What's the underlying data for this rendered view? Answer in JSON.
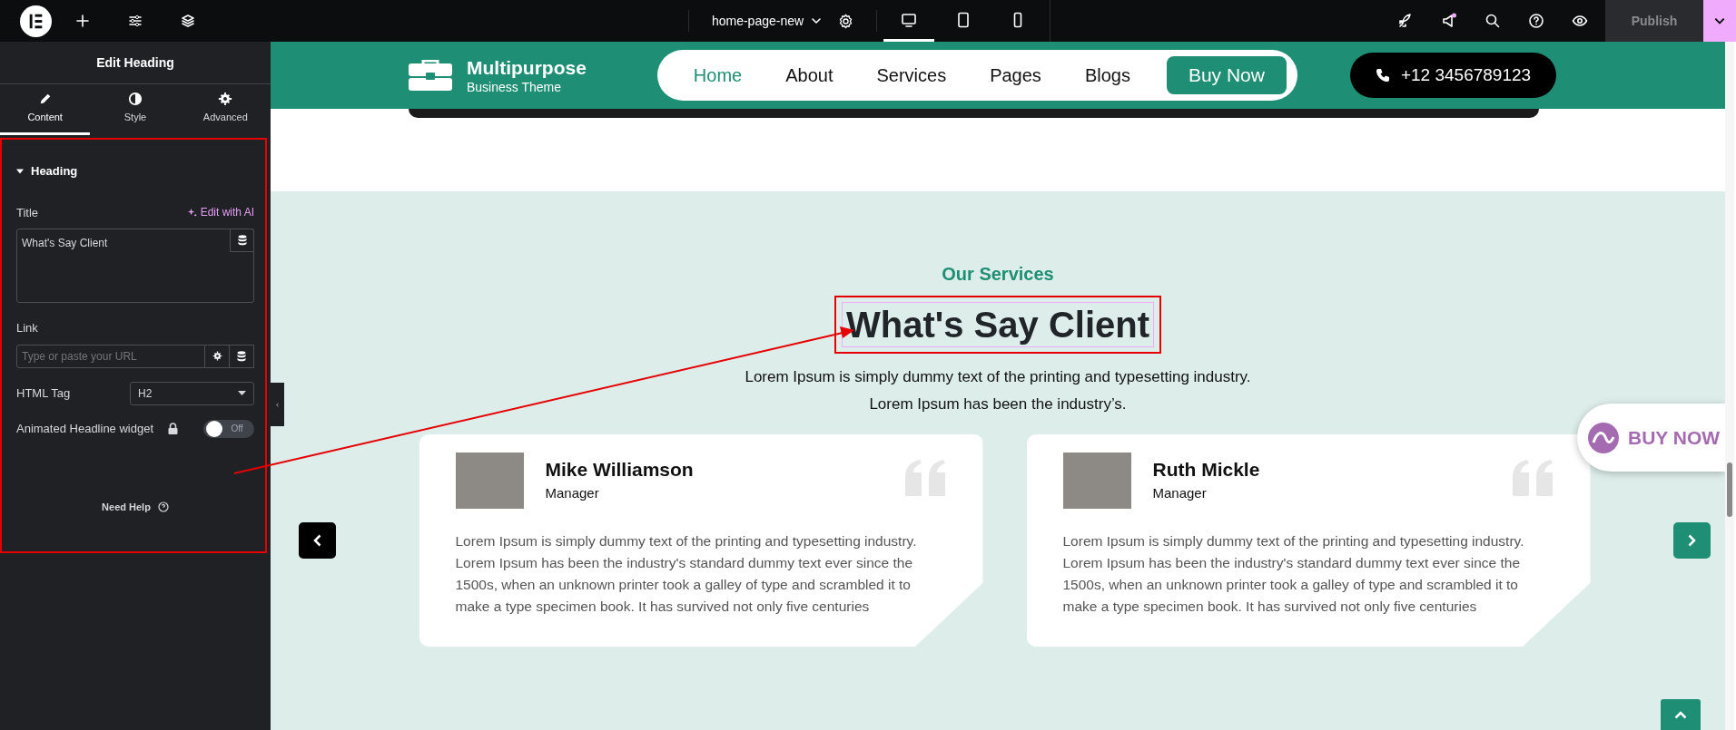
{
  "topbar": {
    "page_name": "home-page-new",
    "devices": [
      {
        "kind": "desktop",
        "selected": true
      },
      {
        "kind": "tablet",
        "selected": false
      },
      {
        "kind": "mobile",
        "selected": false
      }
    ],
    "publish": {
      "label": "Publish",
      "disabled": true
    }
  },
  "panel": {
    "title": "Edit Heading",
    "tabs": [
      {
        "kind": "pencil",
        "label": "Content",
        "selected": true
      },
      {
        "kind": "contrast",
        "label": "Style",
        "selected": false
      },
      {
        "kind": "gear",
        "label": "Advanced",
        "selected": false
      }
    ],
    "section": {
      "title": "Heading",
      "expanded": true
    },
    "title_field": {
      "label": "Title",
      "ai_link": "Edit with AI",
      "value": "What's Say Client"
    },
    "link_field": {
      "label": "Link",
      "placeholder": "Type or paste your URL"
    },
    "tag_field": {
      "label": "HTML Tag",
      "value": "H2"
    },
    "toggle": {
      "label": "Animated Headline widget",
      "on": false,
      "state_label": "Off"
    },
    "help": "Need Help"
  },
  "site": {
    "logo": {
      "title": "Multipurpose",
      "subtitle": "Business Theme"
    },
    "nav": [
      {
        "label": "Home",
        "selected": true
      },
      {
        "label": "About",
        "selected": false
      },
      {
        "label": "Services",
        "selected": false
      },
      {
        "label": "Pages",
        "selected": false
      },
      {
        "label": "Blogs",
        "selected": false
      }
    ],
    "cta": "Buy Now",
    "phone": "+12 3456789123"
  },
  "testimonials_section": {
    "eyebrow": "Our Services",
    "heading": "What's Say Client",
    "intro": [
      "Lorem Ipsum is simply dummy text of the printing and typesetting industry.",
      "Lorem Ipsum has been the industry’s."
    ],
    "cards": [
      {
        "name": "Mike Williamson",
        "role": "Manager",
        "text": "Lorem Ipsum is simply dummy text of the printing and typesetting industry. Lorem Ipsum has been the industry's standard dummy text ever since the 1500s, when an unknown printer took a galley of type and scrambled it to make a type specimen book. It has survived not only five centuries"
      },
      {
        "name": "Ruth Mickle",
        "role": "Manager",
        "text": "Lorem Ipsum is simply dummy text of the printing and typesetting industry. Lorem Ipsum has been the industry's standard dummy text ever since the 1500s, when an unknown printer took a galley of type and scrambled it to make a type specimen book. It has survived not only five centuries"
      }
    ]
  },
  "floating_cta": "BUY NOW"
}
